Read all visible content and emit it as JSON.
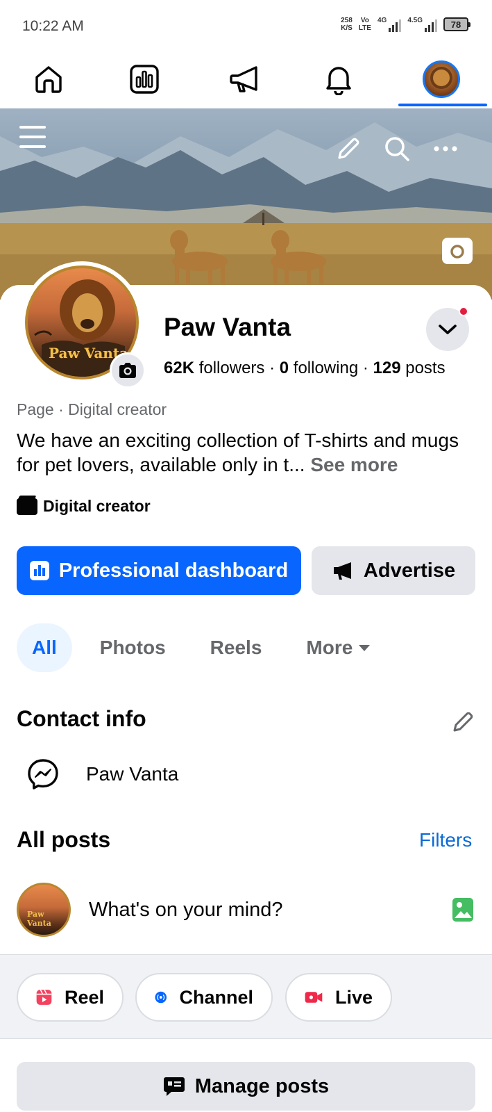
{
  "status_bar": {
    "time": "10:22 AM",
    "net_speed_value": "258",
    "net_speed_unit": "K/S",
    "volte_top": "Vo",
    "volte_bottom": "LTE",
    "signal1_label": "4G",
    "signal2_label": "4.5G",
    "battery": "78"
  },
  "top_nav": {
    "items": [
      "home-icon",
      "dashboard-icon",
      "megaphone-icon",
      "bell-icon",
      "profile-avatar"
    ],
    "active": "profile-avatar"
  },
  "cover": {
    "icons": [
      "menu-icon",
      "edit-icon",
      "search-icon",
      "more-icon",
      "camera-icon"
    ]
  },
  "profile": {
    "name": "Paw Vanta",
    "picture_text": "Paw Vanta",
    "followers_count": "62K",
    "followers_label": "followers",
    "following_count": "0",
    "following_label": "following",
    "posts_count": "129",
    "posts_label": "posts",
    "category": "Page · Digital creator",
    "bio": "We have an exciting collection of T-shirts and mugs for pet lovers, available only in t...",
    "see_more": "See more",
    "creator_tag": "Digital creator"
  },
  "buttons": {
    "professional_dashboard": "Professional dashboard",
    "advertise": "Advertise",
    "manage_posts": "Manage posts"
  },
  "tabs": {
    "all": "All",
    "photos": "Photos",
    "reels": "Reels",
    "more": "More"
  },
  "contact_info": {
    "title": "Contact info",
    "messenger_name": "Paw Vanta"
  },
  "all_posts": {
    "title": "All posts",
    "filters": "Filters",
    "composer_placeholder": "What's on your mind?",
    "composer_avatar_text": "Paw Vanta"
  },
  "actions": {
    "reel": "Reel",
    "channel": "Channel",
    "live": "Live"
  },
  "colors": {
    "accent": "#0866ff",
    "link": "#0a6ad6",
    "secondary_text": "#65676b",
    "button_gray": "#e4e6eb",
    "photo_green": "#45bd62",
    "reel_red": "#f3425f",
    "live_red": "#f02849",
    "channel_blue": "#0866ff"
  }
}
